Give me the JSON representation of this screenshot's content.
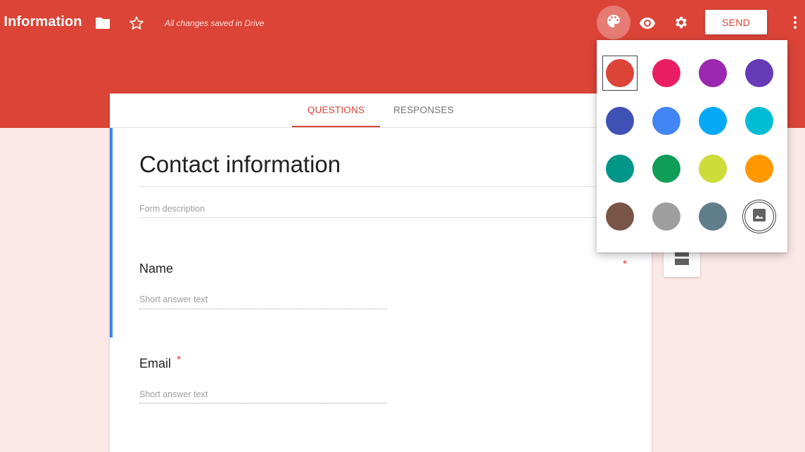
{
  "header": {
    "title": "t Information",
    "saved_status": "All changes saved in Drive",
    "send_label": "SEND",
    "icons": [
      "folder-icon",
      "star-icon",
      "palette-icon",
      "eye-icon",
      "gear-icon",
      "more-vert-icon"
    ],
    "bar_color": "#db4437"
  },
  "tabs": [
    {
      "label": "QUESTIONS",
      "active": true
    },
    {
      "label": "RESPONSES",
      "active": false
    }
  ],
  "form": {
    "title": "Contact information",
    "description_placeholder": "Form description",
    "questions": [
      {
        "title": "Name",
        "placeholder": "Short answer text",
        "required": true,
        "required_mark": "*"
      },
      {
        "title": "Email",
        "placeholder": "Short answer text",
        "required": true,
        "required_mark": "*"
      }
    ]
  },
  "theme_popup": {
    "colors": [
      "#db4437",
      "#e91e63",
      "#9c27b0",
      "#673ab7",
      "#3f51b5",
      "#4285f4",
      "#03a9f4",
      "#00bcd4",
      "#009688",
      "#0f9d58",
      "#cddc39",
      "#ff9800",
      "#795548",
      "#9e9e9e",
      "#607d8b"
    ],
    "selected_color": "#db4437",
    "custom_image_icon": "image-icon"
  },
  "side_toolbar": {
    "icon": "section-icon"
  }
}
